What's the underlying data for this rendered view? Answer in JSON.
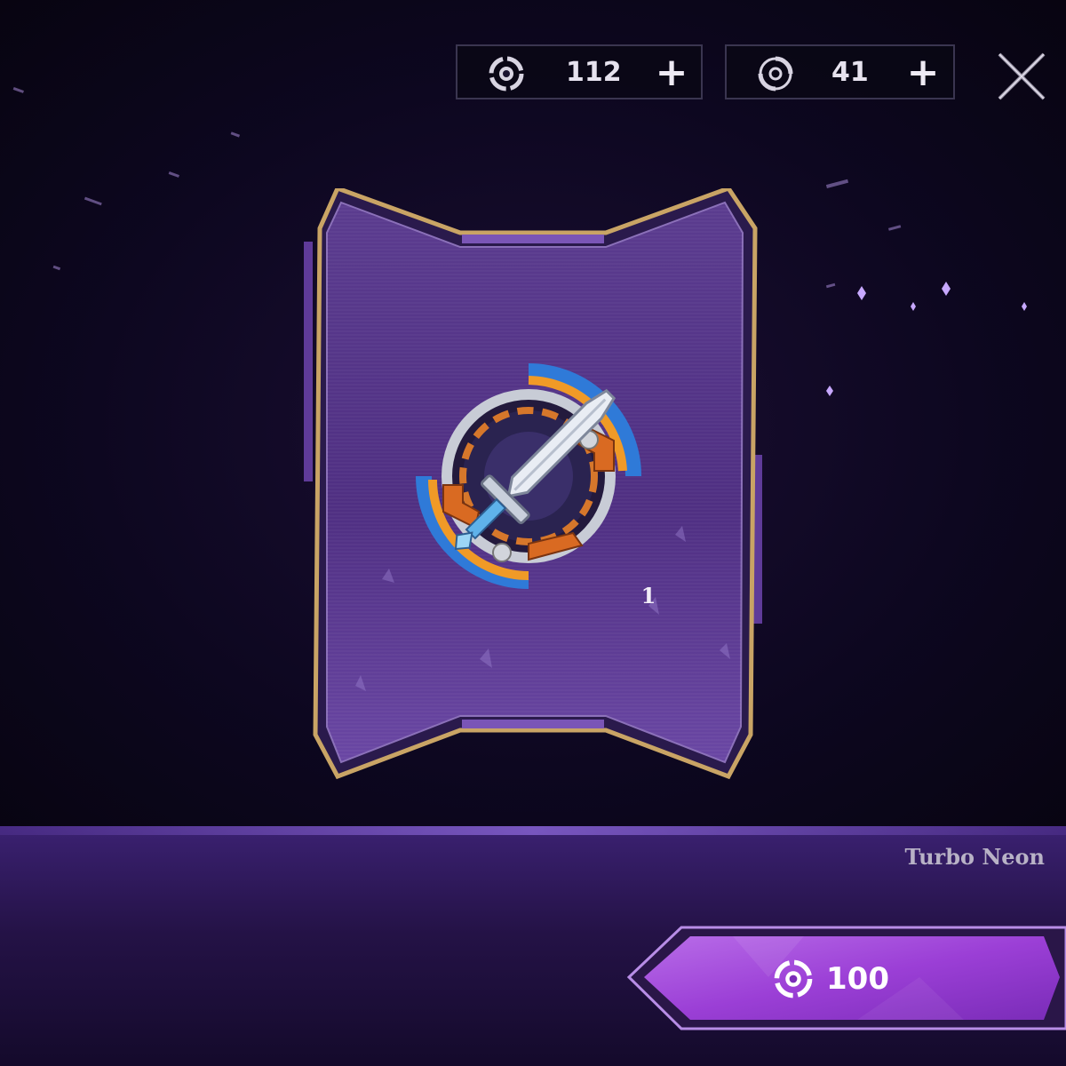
{
  "currencies": [
    {
      "name": "tokens",
      "amount": "112",
      "add_label": "+",
      "icon": "token-icon"
    },
    {
      "name": "essence",
      "amount": "41",
      "add_label": "+",
      "icon": "swirl-icon"
    }
  ],
  "close": {
    "icon": "close-icon"
  },
  "card": {
    "item_icon": "sword-emblem-icon",
    "count": "1"
  },
  "item": {
    "name": "Turbo Neon"
  },
  "purchase": {
    "price": "100",
    "currency_icon": "token-icon"
  },
  "colors": {
    "accent_purple": "#a24fe0",
    "gold_frame": "#c9a465",
    "card_fill": "#5a3a8f"
  }
}
